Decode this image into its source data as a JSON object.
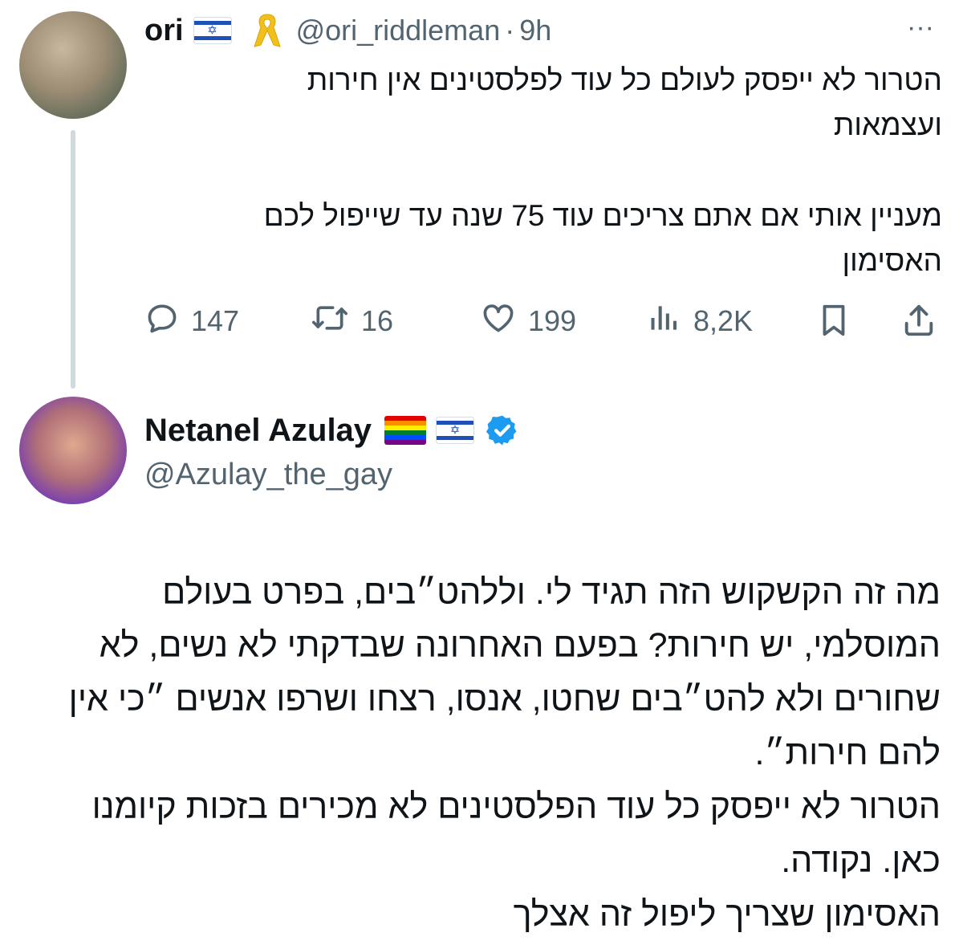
{
  "tweet1": {
    "name": "ori",
    "handle": "@ori_riddleman",
    "time": "9h",
    "more": "···",
    "line1": "הטרור לא ייפסק לעולם כל עוד לפלסטינים אין חירות",
    "line2": "ועצמאות",
    "line3": "מעניין אותי אם אתם צריכים עוד 75 שנה עד שייפול לכם",
    "line4": "האסימון",
    "stats": {
      "replies": "147",
      "retweets": "16",
      "likes": "199",
      "views": "8,2K"
    }
  },
  "tweet2": {
    "name": "Netanel Azulay",
    "handle": "@Azulay_the_gay",
    "lines": [
      "מה זה הקשקוש הזה תגיד לי. וללהט״בים, בפרט בעולם",
      "המוסלמי, יש חירות? בפעם האחרונה שבדקתי לא נשים, לא",
      "שחורים ולא להט״בים שחטו, אנסו, רצחו ושרפו אנשים ״כי אין",
      "להם חירות״.",
      "הטרור לא ייפסק כל עוד הפלסטינים לא מכירים בזכות קיומנו",
      "כאן. נקודה.",
      "האסימון שצריך ליפול זה אצלך"
    ]
  },
  "icons": {
    "flag": "israel-flag-icon",
    "ribbon": "yellow-ribbon-icon",
    "rainbow": "rainbow-flag-icon",
    "verified": "verified-badge-icon",
    "reply": "reply-icon",
    "retweet": "retweet-icon",
    "like": "heart-icon",
    "views": "views-icon",
    "bookmark": "bookmark-icon",
    "share": "share-icon"
  },
  "colors": {
    "text": "#0f1419",
    "secondary": "#536471",
    "verified": "#1d9bf0",
    "ribbon": "#f2c01d",
    "thread_line": "#cfd9de"
  }
}
